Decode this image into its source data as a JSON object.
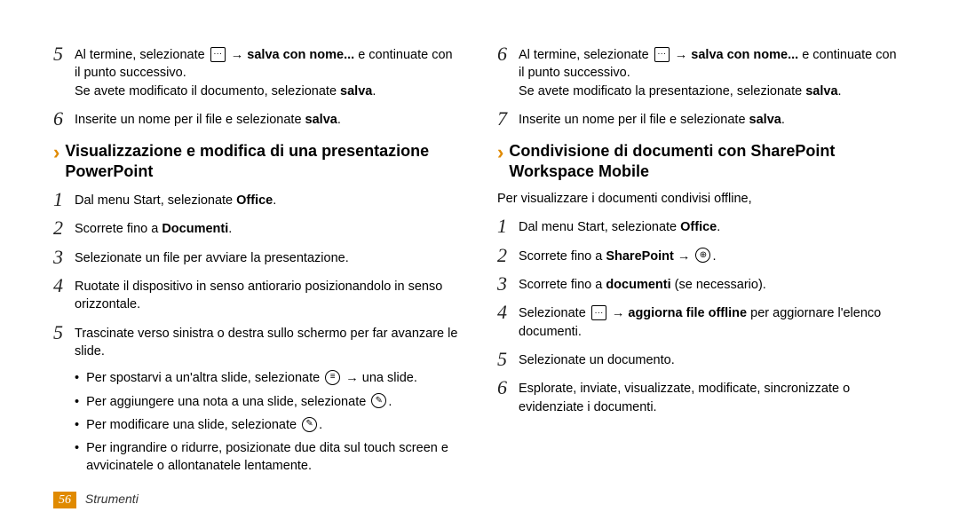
{
  "left": {
    "step5": {
      "part1": "Al termine, selezionate ",
      "part2": " → ",
      "bold": "salva con nome...",
      "part3": " e continuate con il punto successivo.",
      "sub_pre": "Se avete modificato il documento, selezionate ",
      "sub_bold": "salva",
      "sub_post": "."
    },
    "step6_pre": "Inserite un nome per il file e selezionate ",
    "step6_bold": "salva",
    "step6_post": ".",
    "section_title": "Visualizzazione e modifica di una presentazione PowerPoint",
    "s1_pre": "Dal menu Start, selezionate ",
    "s1_bold": "Office",
    "s1_post": ".",
    "s2_pre": "Scorrete fino a ",
    "s2_bold": "Documenti",
    "s2_post": ".",
    "s3": "Selezionate un file per avviare la presentazione.",
    "s4": "Ruotate il dispositivo in senso antiorario posizionandolo in senso orizzontale.",
    "s5": "Trascinate verso sinistra o destra sullo schermo per far avanzare le slide.",
    "b1_pre": "Per spostarvi a un'altra slide, selezionate ",
    "b1_post": " → una slide.",
    "b2_pre": "Per aggiungere una nota a una slide, selezionate ",
    "b2_post": ".",
    "b3_pre": "Per modificare una slide, selezionate ",
    "b3_post": ".",
    "b4": "Per ingrandire o ridurre, posizionate due dita sul touch screen e avvicinatele o allontanatele lentamente."
  },
  "right": {
    "step6": {
      "part1": "Al termine, selezionate ",
      "part2": " → ",
      "bold": "salva con nome...",
      "part3": "  e continuate con il punto successivo.",
      "sub_pre": "Se avete modificato la presentazione, selezionate ",
      "sub_bold": "salva",
      "sub_post": "."
    },
    "step7_pre": "Inserite un nome per il file e selezionate ",
    "step7_bold": "salva",
    "step7_post": ".",
    "section_title": "Condivisione di documenti con SharePoint Workspace Mobile",
    "intro": "Per visualizzare i documenti condivisi offline,",
    "s1_pre": "Dal menu Start, selezionate ",
    "s1_bold": "Office",
    "s1_post": ".",
    "s2_pre": "Scorrete fino a ",
    "s2_bold": "SharePoint",
    "s2_mid": " → ",
    "s2_post": ".",
    "s3_pre": "Scorrete fino a ",
    "s3_bold": "documenti",
    "s3_post": " (se necessario).",
    "s4_pre": "Selezionate ",
    "s4_mid": " → ",
    "s4_bold": "aggiorna file offline",
    "s4_post": " per aggiornare l'elenco documenti.",
    "s5": "Selezionate un documento.",
    "s6": "Esplorate, inviate, visualizzate, modificate, sincronizzate o evidenziate i documenti."
  },
  "footer": {
    "page": "56",
    "label": "Strumenti"
  },
  "icons": {
    "dots": "···",
    "list": "≡",
    "note": "✎",
    "edit": "✎",
    "all": "⊕"
  }
}
